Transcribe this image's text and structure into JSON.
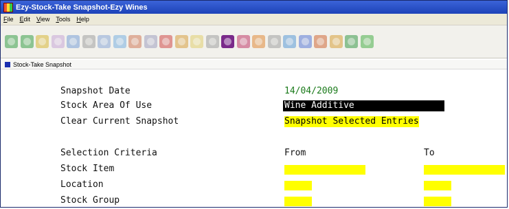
{
  "window": {
    "title": "Ezy-Stock-Take Snapshot-Ezy Wines"
  },
  "menu": [
    "File",
    "Edit",
    "View",
    "Tools",
    "Help"
  ],
  "toolbar": {
    "icons": [
      {
        "name": "back-arrow-icon",
        "color": "#3aa04a"
      },
      {
        "name": "forward-arrow-icon",
        "color": "#3aa04a"
      },
      {
        "name": "people-icon",
        "color": "#d8b83a"
      },
      {
        "name": "people2-icon",
        "color": "#c8a8d8"
      },
      {
        "name": "truck-icon",
        "color": "#7aa0d8"
      },
      {
        "name": "printer-icon",
        "color": "#a0a0a0"
      },
      {
        "name": "pencil-icon",
        "color": "#8aa8d8"
      },
      {
        "name": "calculator-icon",
        "color": "#7ab0e0"
      },
      {
        "name": "users-icon",
        "color": "#d07a5a"
      },
      {
        "name": "edit-icon",
        "color": "#a0a0c0"
      },
      {
        "name": "mail-icon",
        "color": "#d04a4a"
      },
      {
        "name": "cup-icon",
        "color": "#d8a040"
      },
      {
        "name": "glass-icon",
        "color": "#e0d070"
      },
      {
        "name": "bottle-icon",
        "color": "#a0a0a0"
      },
      {
        "name": "wine-icon",
        "color": "#7a2a8a",
        "active": true
      },
      {
        "name": "grapes-icon",
        "color": "#c03a6a"
      },
      {
        "name": "box-icon",
        "color": "#e08a3a"
      },
      {
        "name": "gear-icon",
        "color": "#a0a0a0"
      },
      {
        "name": "globe-icon",
        "color": "#5a9ad8"
      },
      {
        "name": "help-icon",
        "color": "#5a7ad8"
      },
      {
        "name": "book-icon",
        "color": "#d06a3a"
      },
      {
        "name": "package-icon",
        "color": "#d8a03a"
      },
      {
        "name": "tree-icon",
        "color": "#3a9a4a"
      },
      {
        "name": "money-icon",
        "color": "#4ab04a"
      }
    ]
  },
  "document": {
    "title": "Stock-Take Snapshot"
  },
  "form": {
    "snapshot_date_label": "Snapshot Date",
    "snapshot_date_value": "14/04/2009",
    "stock_area_label": "Stock Area Of Use",
    "stock_area_value": "Wine Additive",
    "clear_label": "Clear Current Snapshot",
    "clear_value": "Snapshot Selected Entries",
    "criteria_label": "Selection Criteria",
    "from_header": "From",
    "to_header": "To",
    "stock_item_label": "Stock Item",
    "location_label": "Location",
    "stock_group_label": "Stock Group"
  }
}
